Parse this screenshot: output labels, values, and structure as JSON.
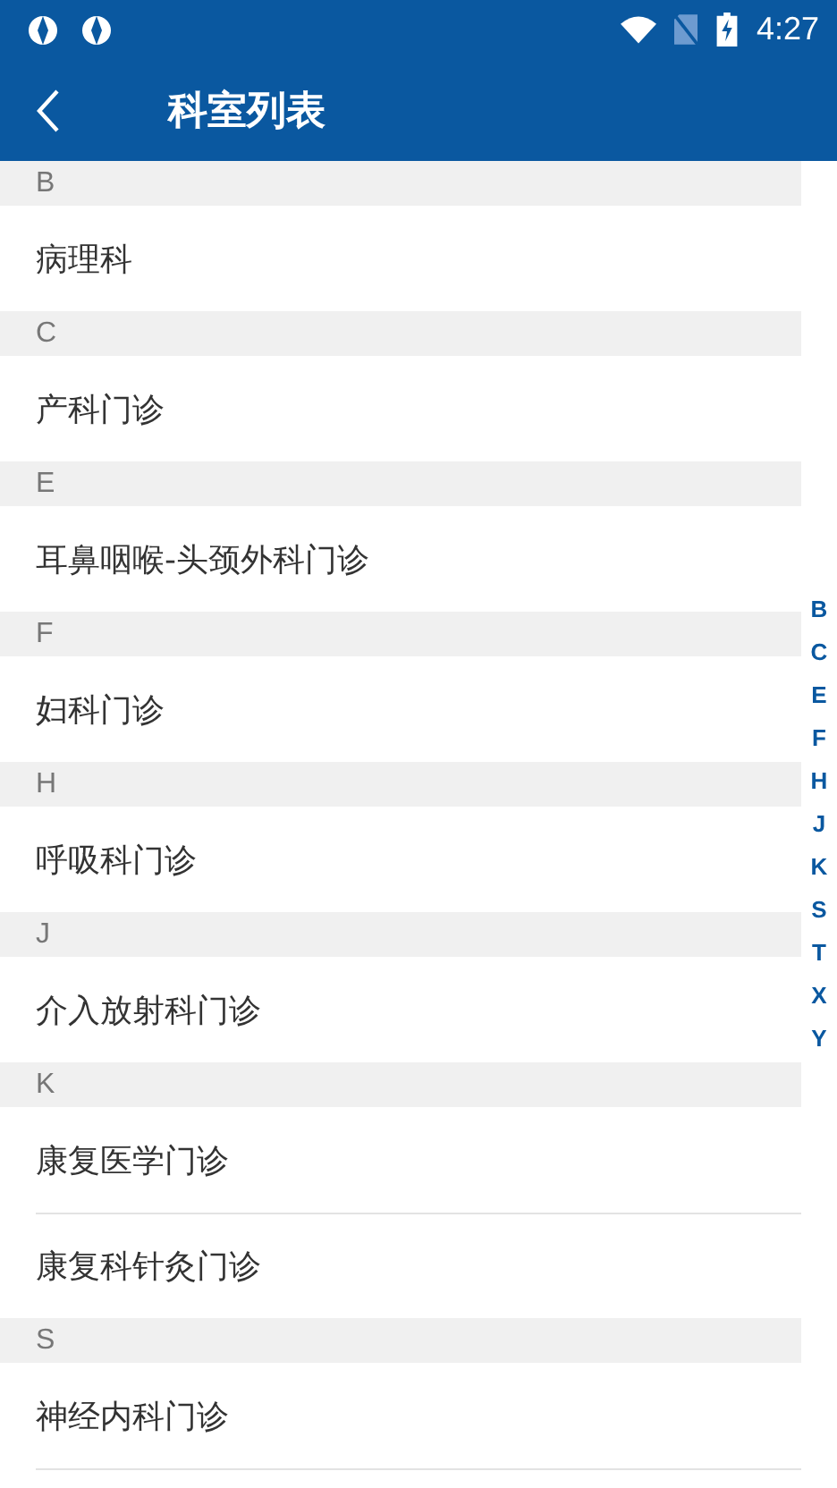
{
  "status_bar": {
    "time": "4:27"
  },
  "header": {
    "title": "科室列表"
  },
  "sections": [
    {
      "letter": "B",
      "items": [
        "病理科"
      ]
    },
    {
      "letter": "C",
      "items": [
        "产科门诊"
      ]
    },
    {
      "letter": "E",
      "items": [
        "耳鼻咽喉-头颈外科门诊"
      ]
    },
    {
      "letter": "F",
      "items": [
        "妇科门诊"
      ]
    },
    {
      "letter": "H",
      "items": [
        "呼吸科门诊"
      ]
    },
    {
      "letter": "J",
      "items": [
        "介入放射科门诊"
      ]
    },
    {
      "letter": "K",
      "items": [
        "康复医学门诊",
        "康复科针灸门诊"
      ]
    },
    {
      "letter": "S",
      "items": [
        "神经内科门诊"
      ]
    }
  ],
  "index_bar": [
    "B",
    "C",
    "E",
    "F",
    "H",
    "J",
    "K",
    "S",
    "T",
    "X",
    "Y"
  ]
}
